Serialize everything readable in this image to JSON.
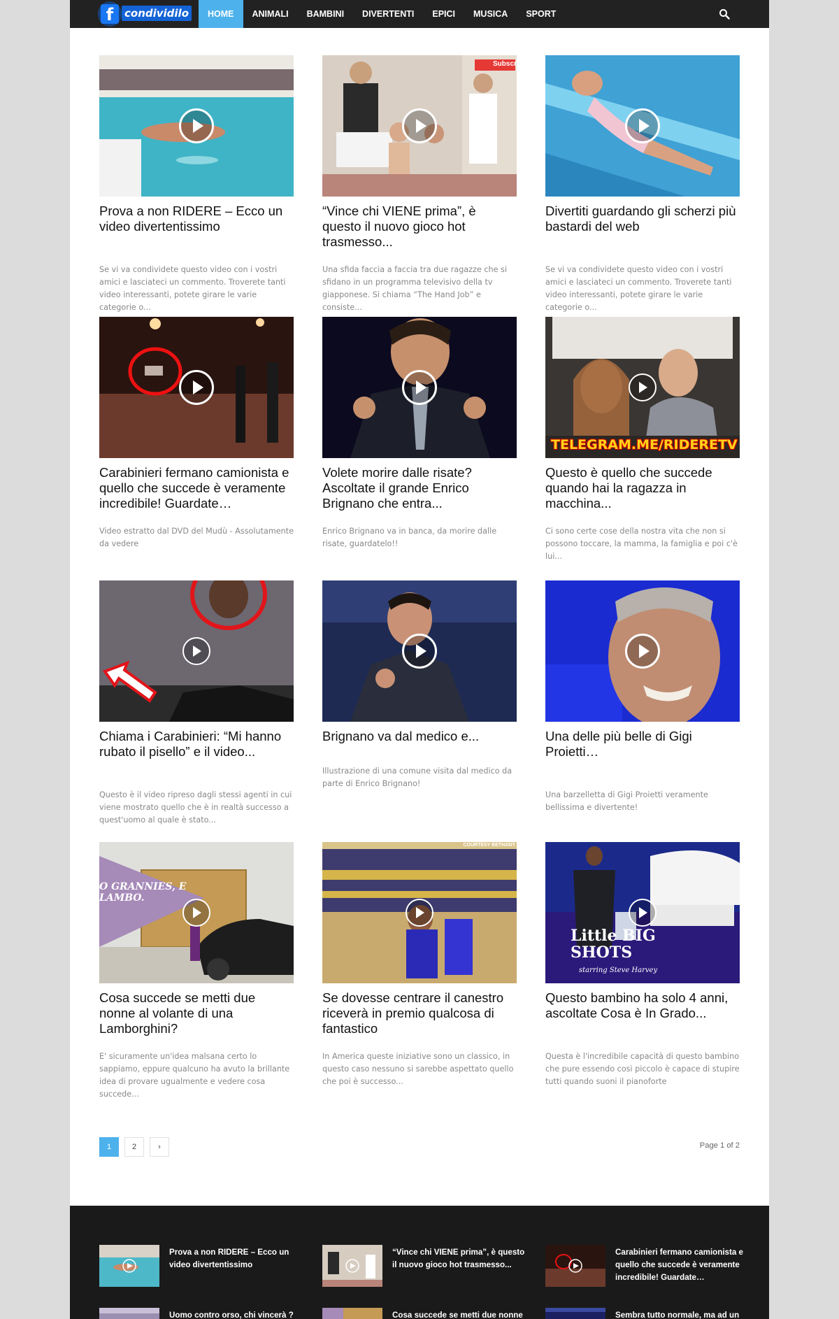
{
  "site": {
    "logo_text": "condividilo",
    "logo_letter": "f"
  },
  "nav": {
    "items": [
      "HOME",
      "ANIMALI",
      "BAMBINI",
      "DIVERTENTI",
      "EPICI",
      "MUSICA",
      "SPORT"
    ],
    "active": "HOME"
  },
  "colors": {
    "accent": "#4db2ec",
    "topbar": "#222222",
    "footer": "#1a1a1a"
  },
  "posts": [
    {
      "title": "Prova a non RIDERE – Ecco un video divertentissimo",
      "excerpt": "Se vi va condividete questo video con i vostri amici e lasciateci un commento. Troverete tanti video interessanti, potete girare le varie categorie o...",
      "thumb_icon": "swimmer-image"
    },
    {
      "title": "“Vince chi VIENE prima”, è questo il nuovo gioco hot trasmesso...",
      "excerpt": "Una sfida faccia a faccia tra due ragazze che si sfidano in un programma televisivo della tv giapponese. Si chiama “The Hand Job” e consiste...",
      "thumb_icon": "tv-show-image",
      "thumb_badge": "Subscri"
    },
    {
      "title": "Divertiti guardando gli scherzi più bastardi del web",
      "excerpt": "Se vi va condividete questo video con i vostri amici e lasciateci un commento. Troverete tanti video interessanti, potete girare le varie categorie o...",
      "thumb_icon": "pool-image"
    },
    {
      "title": "Carabinieri fermano camionista e quello che succede è veramente incredibile! Guardate…",
      "excerpt": "Video estratto dal DVD del Mudù - Assolutamente da vedere",
      "thumb_icon": "night-street-image"
    },
    {
      "title": "Volete morire dalle risate? Ascoltate il grande Enrico Brignano che entra...",
      "excerpt": "Enrico Brignano va in banca, da morire dalle risate, guardatelo!!",
      "thumb_icon": "comedian-image"
    },
    {
      "title": "Questo è quello che succede quando hai la ragazza in macchina...",
      "excerpt": "Ci sono certe cose della nostra vita che non si possono toccare, la mamma, la famiglia e poi c'è lui...",
      "thumb_icon": "car-couple-image",
      "thumb_badge": "TELEGRAM.ME/RIDERETV"
    },
    {
      "title": "Chiama i Carabinieri: “Mi hanno rubato il pisello” e il video...",
      "excerpt": "Questo è il video ripreso dagli stessi agenti in cui viene mostrato quello che è in realtà successo a quest'uomo al quale è stato...",
      "thumb_icon": "arrow-circle-image"
    },
    {
      "title": "Brignano va dal medico e...",
      "excerpt": "Illustrazione di una comune visita dal medico da parte di Enrico Brignano!",
      "thumb_icon": "comedian-stage-image"
    },
    {
      "title": "Una delle più belle di Gigi Proietti…",
      "excerpt": "Una barzelletta di Gigi Proietti veramente bellissima e divertente!",
      "thumb_icon": "smiling-man-image"
    },
    {
      "title": "Cosa succede se metti due nonne al volante di una Lamborghini?",
      "excerpt": "E' sicuramente un'idea malsana certo lo sappiamo, eppure qualcuno ha avuto la brillante idea di provare ugualmente e vedere cosa succede...",
      "thumb_icon": "lamborghini-image",
      "thumb_badge": "O GRANNIES, E LAMBO."
    },
    {
      "title": "Se dovesse centrare il canestro riceverà in premio qualcosa di fantastico",
      "excerpt": "In America queste iniziative sono un classico, in questo caso nessuno si sarebbe aspettato quello che poi è successo...",
      "thumb_icon": "gym-image",
      "thumb_badge": "COURTESY BETHANY"
    },
    {
      "title": "Questo bambino ha solo 4 anni, ascoltate Cosa è In Grado...",
      "excerpt": "Questa è l'incredibile capacità di questo bambino che pure essendo così piccolo è capace di stupire tutti quando suoni il pianoforte",
      "thumb_icon": "piano-show-image",
      "thumb_badge": "Little BIG SHOTS",
      "thumb_badge2": "starring Steve Harvey"
    }
  ],
  "pagination": {
    "pages": [
      "1",
      "2"
    ],
    "current": "1",
    "next": "›",
    "info": "Page 1 of 2"
  },
  "footer": {
    "items": [
      {
        "title": "Prova a non RIDERE – Ecco un video divertentissimo"
      },
      {
        "title": "“Vince chi VIENE prima”, è questo il nuovo gioco hot trasmesso..."
      },
      {
        "title": "Carabinieri fermano camionista e quello che succede è veramente incredibile! Guardate…"
      },
      {
        "title": "Uomo contro orso, chi vincerà ?"
      },
      {
        "title": "Cosa succede se metti due nonne"
      },
      {
        "title": "Sembra tutto normale, ma ad un"
      }
    ]
  }
}
